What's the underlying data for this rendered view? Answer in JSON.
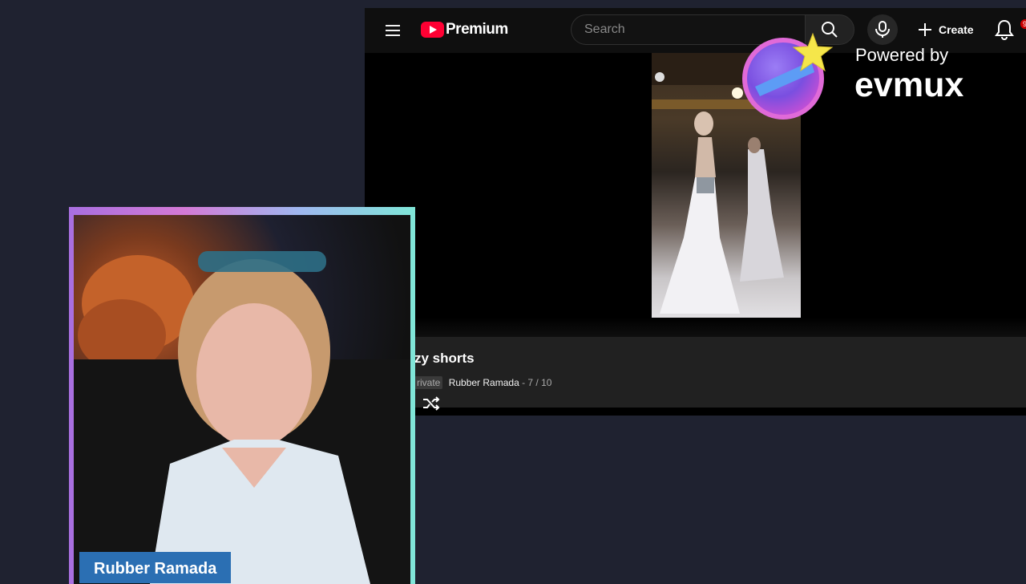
{
  "youtube": {
    "logo_label": "Premium",
    "search": {
      "placeholder": "Search",
      "value": ""
    },
    "create_label": "Create",
    "notifications_badge": "9+",
    "playlist": {
      "title": "zy shorts",
      "visibility": "rivate",
      "owner": "Rubber Ramada",
      "position": "- 7 / 10"
    }
  },
  "overlay": {
    "powered_by": "Powered by",
    "brand": "evmux"
  },
  "webcam": {
    "name_tag": "Rubber Ramada"
  },
  "colors": {
    "page_bg": "#1f2230",
    "youtube_red": "#ff0033",
    "badge_red": "#cc0000",
    "name_tag_bg": "#2b6fb3",
    "frame_gradient": [
      "#a86fe0",
      "#d47ad6",
      "#9fb8f0",
      "#7fe6d8"
    ]
  },
  "icons": [
    "menu-icon",
    "youtube-logo-icon",
    "search-icon",
    "mic-icon",
    "plus-icon",
    "bell-icon",
    "shuffle-icon",
    "evmux-logo-icon",
    "star-icon"
  ]
}
